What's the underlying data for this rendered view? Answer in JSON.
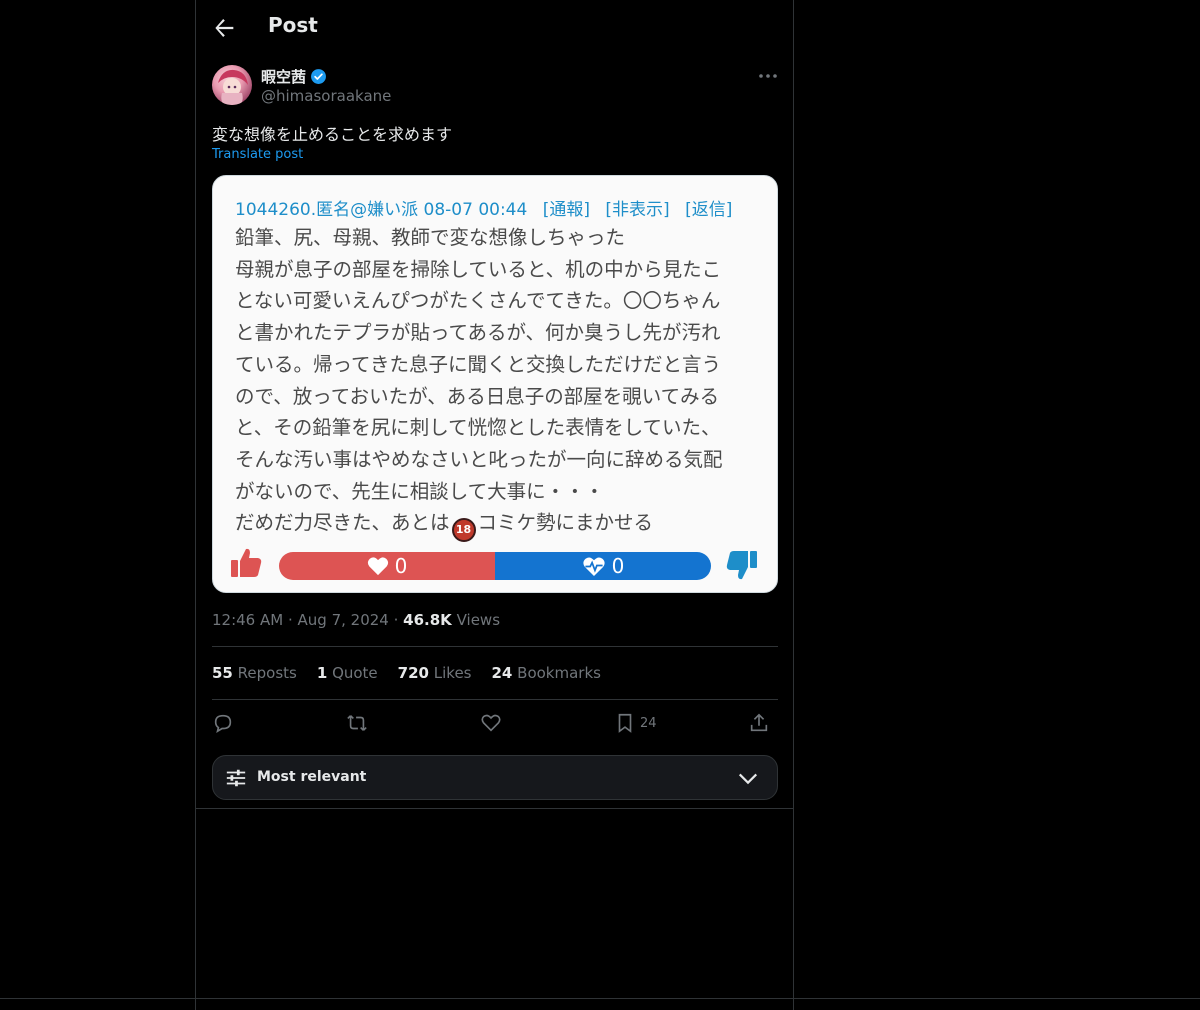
{
  "header": {
    "title": "Post"
  },
  "author": {
    "name": "暇空茜",
    "handle": "@himasoraakane"
  },
  "post": {
    "text": "変な想像を止めることを求めます",
    "translate_label": "Translate post"
  },
  "card": {
    "header_items": [
      "1044260.匿名@嫌い派 08-07 00:44",
      "[通報]",
      "[非表示]",
      "[返信]"
    ],
    "lines": [
      "鉛筆、尻、母親、教師で変な想像しちゃった",
      "母親が息子の部屋を掃除していると、机の中から見たこ",
      "とない可愛いえんぴつがたくさんでてきた。〇〇ちゃん",
      "と書かれたテプラが貼ってあるが、何か臭うし先が汚れ",
      "ている。帰ってきた息子に聞くと交換しただけだと言う",
      "ので、放っておいたが、ある日息子の部屋を覗いてみる",
      "と、その鉛筆を尻に刺して恍惚とした表情をしていた、",
      "そんな汚い事はやめなさいと叱ったが一向に辞める気配",
      "がないので、先生に相談して大事に・・・"
    ],
    "last_line_before": "だめだ力尽きた、あとは",
    "r18_badge": "18",
    "last_line_after": "コミケ勢にまかせる",
    "like_count": "0",
    "love_count": "0"
  },
  "meta": {
    "time": "12:46 AM",
    "date": "Aug 7, 2024",
    "views_count": "46.8K",
    "views_label": "Views"
  },
  "stats": {
    "reposts_count": "55",
    "reposts_label": "Reposts",
    "quote_count": "1",
    "quote_label": "Quote",
    "likes_count": "720",
    "likes_label": "Likes",
    "bookmarks_count": "24",
    "bookmarks_label": "Bookmarks"
  },
  "actions": {
    "bookmark_count": "24"
  },
  "sort": {
    "label": "Most relevant"
  },
  "colors": {
    "accent": "#1d9bf0",
    "like_red": "#dd5453",
    "love_blue": "#1474d0"
  }
}
